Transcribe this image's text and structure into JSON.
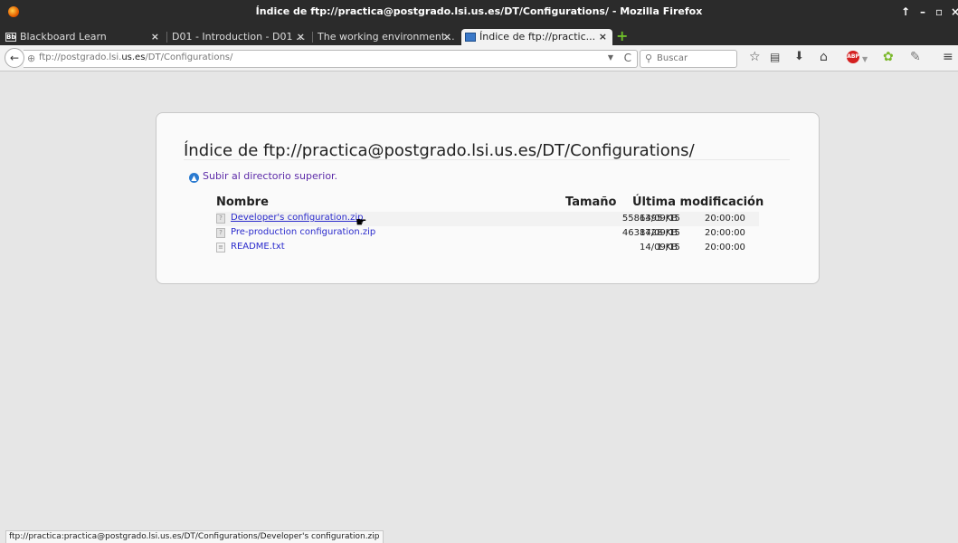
{
  "window": {
    "title": "Índice de ftp://practica@postgrado.lsi.us.es/DT/Configurations/ - Mozilla Firefox",
    "controls": [
      "↑",
      "–",
      "▫",
      "×"
    ]
  },
  "tabs": [
    {
      "label": "Blackboard Learn",
      "favicon": "Bb",
      "close": "×"
    },
    {
      "label": "D01 - Introduction - D01 ...",
      "close": "×"
    },
    {
      "label": "The working environment...",
      "close": "×"
    },
    {
      "label": "Índice de ftp://practic...",
      "close": "×",
      "active": true
    }
  ],
  "new_tab": "+",
  "nav": {
    "back": "←",
    "url_prefix": "ftp://postgrado.lsi.",
    "url_domain": "us.es",
    "url_path": "/DT/Configurations/",
    "url_dropdown": "▼",
    "reload": "C",
    "search_placeholder": "Buscar",
    "toolbar_icons": [
      "star-icon",
      "reading-list-icon",
      "download-icon",
      "home-icon",
      "adblock-icon",
      "extension-icon",
      "tools-icon",
      "menu-icon"
    ]
  },
  "listing": {
    "heading": "Índice de ftp://practica@postgrado.lsi.us.es/DT/Configurations/",
    "up_link": "Subir al directorio superior.",
    "col_name": "Nombre",
    "col_size": "Tamaño",
    "col_modified": "Última modificación",
    "files": [
      {
        "name": "Developer's configuration.zip",
        "size": "5586395 KB",
        "date": "14/09/15",
        "time": "20:00:00",
        "type": "zip"
      },
      {
        "name": "Pre-production configuration.zip",
        "size": "4638728 KB",
        "date": "14/09/15",
        "time": "20:00:00",
        "type": "zip"
      },
      {
        "name": "README.txt",
        "size": "1 KB",
        "date": "14/09/15",
        "time": "20:00:00",
        "type": "txt"
      }
    ]
  },
  "status": "ftp://practica:practica@postgrado.lsi.us.es/DT/Configurations/Developer's configuration.zip",
  "colors": {
    "link": "#2a2acc",
    "visited": "#5c2aa8",
    "chrome": "#2b2b2b"
  }
}
